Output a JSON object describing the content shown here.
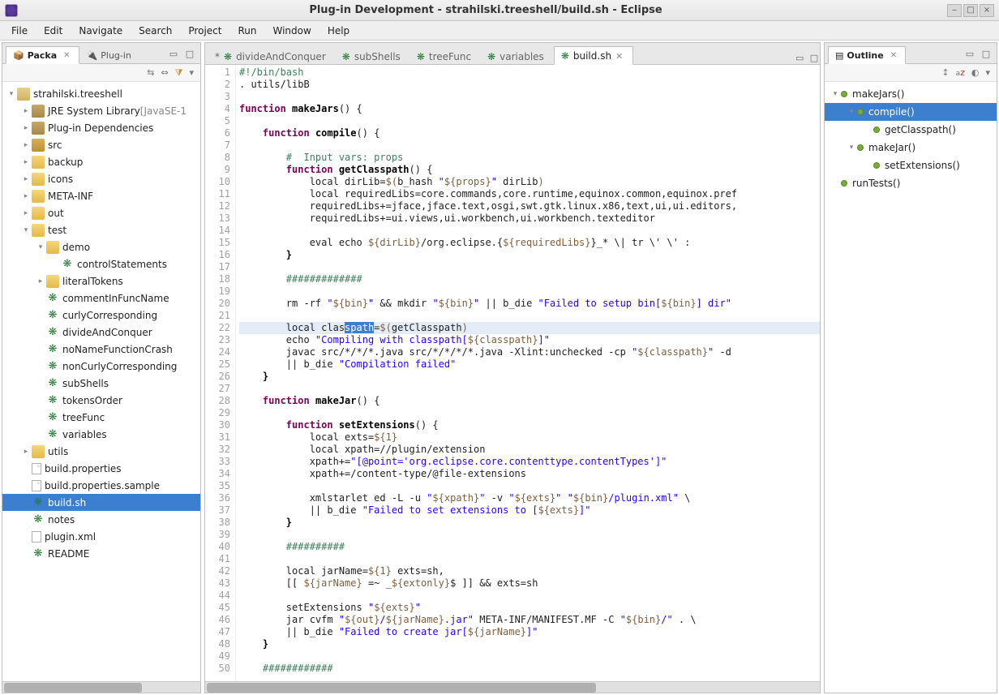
{
  "window": {
    "title": "Plug-in Development - strahilski.treeshell/build.sh - Eclipse"
  },
  "menubar": [
    "File",
    "Edit",
    "Navigate",
    "Search",
    "Project",
    "Run",
    "Window",
    "Help"
  ],
  "left": {
    "tabs": [
      {
        "label": "Packa",
        "active": true,
        "icon": "package-explorer"
      },
      {
        "label": "Plug-in",
        "active": false,
        "icon": "plugin"
      }
    ],
    "project": "strahilski.treeshell",
    "tree": [
      {
        "depth": 1,
        "tw": "+",
        "icon": "lib",
        "label": "JRE System Library",
        "suffix": " [JavaSE-1"
      },
      {
        "depth": 1,
        "tw": "+",
        "icon": "lib",
        "label": "Plug-in Dependencies"
      },
      {
        "depth": 1,
        "tw": "+",
        "icon": "folder-src",
        "label": "src"
      },
      {
        "depth": 1,
        "tw": "+",
        "icon": "folder",
        "label": "backup"
      },
      {
        "depth": 1,
        "tw": "+",
        "icon": "folder",
        "label": "icons"
      },
      {
        "depth": 1,
        "tw": "+",
        "icon": "folder",
        "label": "META-INF"
      },
      {
        "depth": 1,
        "tw": "+",
        "icon": "folder",
        "label": "out"
      },
      {
        "depth": 1,
        "tw": "-",
        "icon": "folder",
        "label": "test"
      },
      {
        "depth": 2,
        "tw": "-",
        "icon": "folder",
        "label": "demo"
      },
      {
        "depth": 3,
        "tw": "",
        "icon": "bug",
        "label": "controlStatements"
      },
      {
        "depth": 2,
        "tw": "+",
        "icon": "folder",
        "label": "literalTokens"
      },
      {
        "depth": 2,
        "tw": "",
        "icon": "bug",
        "label": "commentInFuncName"
      },
      {
        "depth": 2,
        "tw": "",
        "icon": "bug",
        "label": "curlyCorresponding"
      },
      {
        "depth": 2,
        "tw": "",
        "icon": "bug",
        "label": "divideAndConquer"
      },
      {
        "depth": 2,
        "tw": "",
        "icon": "bug",
        "label": "noNameFunctionCrash"
      },
      {
        "depth": 2,
        "tw": "",
        "icon": "bug",
        "label": "nonCurlyCorresponding"
      },
      {
        "depth": 2,
        "tw": "",
        "icon": "bug",
        "label": "subShells"
      },
      {
        "depth": 2,
        "tw": "",
        "icon": "bug",
        "label": "tokensOrder"
      },
      {
        "depth": 2,
        "tw": "",
        "icon": "bug",
        "label": "treeFunc"
      },
      {
        "depth": 2,
        "tw": "",
        "icon": "bug",
        "label": "variables"
      },
      {
        "depth": 1,
        "tw": "+",
        "icon": "folder",
        "label": "utils"
      },
      {
        "depth": 1,
        "tw": "",
        "icon": "file",
        "label": "build.properties"
      },
      {
        "depth": 1,
        "tw": "",
        "icon": "file",
        "label": "build.properties.sample"
      },
      {
        "depth": 1,
        "tw": "",
        "icon": "bug",
        "label": "build.sh",
        "selected": true
      },
      {
        "depth": 1,
        "tw": "",
        "icon": "bug",
        "label": "notes"
      },
      {
        "depth": 1,
        "tw": "",
        "icon": "xml",
        "label": "plugin.xml"
      },
      {
        "depth": 1,
        "tw": "",
        "icon": "bug",
        "label": "README"
      }
    ]
  },
  "editor": {
    "tabs": [
      {
        "label": "divideAndConquer",
        "dirty": true
      },
      {
        "label": "subShells"
      },
      {
        "label": "treeFunc"
      },
      {
        "label": "variables"
      },
      {
        "label": "build.sh",
        "active": true
      }
    ],
    "lines": [
      {
        "n": 1,
        "seg": [
          {
            "t": "#!/bin/bash",
            "c": "cmt"
          }
        ]
      },
      {
        "n": 2,
        "seg": [
          {
            "t": ". utils/libB"
          }
        ]
      },
      {
        "n": 3,
        "seg": []
      },
      {
        "n": 4,
        "seg": [
          {
            "t": "function",
            "c": "kw"
          },
          {
            "t": " "
          },
          {
            "t": "makeJars",
            "c": "fn"
          },
          {
            "t": "() {"
          }
        ]
      },
      {
        "n": 5,
        "seg": []
      },
      {
        "n": 6,
        "seg": [
          {
            "t": "    "
          },
          {
            "t": "function",
            "c": "kw"
          },
          {
            "t": " "
          },
          {
            "t": "compile",
            "c": "fn"
          },
          {
            "t": "() {"
          }
        ]
      },
      {
        "n": 7,
        "seg": []
      },
      {
        "n": 8,
        "seg": [
          {
            "t": "        "
          },
          {
            "t": "#  Input vars: props",
            "c": "cmt"
          }
        ]
      },
      {
        "n": 9,
        "seg": [
          {
            "t": "        "
          },
          {
            "t": "function",
            "c": "kw"
          },
          {
            "t": " "
          },
          {
            "t": "getClasspath",
            "c": "fn"
          },
          {
            "t": "() {"
          }
        ]
      },
      {
        "n": 10,
        "seg": [
          {
            "t": "            local dirLib="
          },
          {
            "t": "$(",
            "c": "var"
          },
          {
            "t": "b_hash "
          },
          {
            "t": "\"",
            "c": "str"
          },
          {
            "t": "${props}",
            "c": "var"
          },
          {
            "t": "\"",
            "c": "str"
          },
          {
            "t": " dirLib"
          },
          {
            "t": ")",
            "c": "var"
          }
        ]
      },
      {
        "n": 11,
        "seg": [
          {
            "t": "            local requiredLibs=core.commands,core.runtime,equinox.common,equinox.pref"
          }
        ]
      },
      {
        "n": 12,
        "seg": [
          {
            "t": "            requiredLibs+=jface,jface.text,osgi,swt.gtk.linux.x86,text,ui,ui.editors,"
          }
        ]
      },
      {
        "n": 13,
        "seg": [
          {
            "t": "            requiredLibs+=ui.views,ui.workbench,ui.workbench.texteditor"
          }
        ]
      },
      {
        "n": 14,
        "seg": []
      },
      {
        "n": 15,
        "seg": [
          {
            "t": "            eval echo "
          },
          {
            "t": "${dirLib}",
            "c": "var"
          },
          {
            "t": "/org.eclipse.{"
          },
          {
            "t": "${requiredLibs}",
            "c": "var"
          },
          {
            "t": "}_* \\| tr \\' \\' :"
          }
        ]
      },
      {
        "n": 16,
        "seg": [
          {
            "t": "        "
          },
          {
            "t": "}",
            "c": "fn"
          }
        ]
      },
      {
        "n": 17,
        "seg": []
      },
      {
        "n": 18,
        "seg": [
          {
            "t": "        "
          },
          {
            "t": "#############",
            "c": "cmt"
          }
        ]
      },
      {
        "n": 19,
        "seg": []
      },
      {
        "n": 20,
        "seg": [
          {
            "t": "        rm -rf "
          },
          {
            "t": "\"",
            "c": "str"
          },
          {
            "t": "${bin}",
            "c": "var"
          },
          {
            "t": "\"",
            "c": "str"
          },
          {
            "t": " && mkdir "
          },
          {
            "t": "\"",
            "c": "str"
          },
          {
            "t": "${bin}",
            "c": "var"
          },
          {
            "t": "\"",
            "c": "str"
          },
          {
            "t": " || b_die "
          },
          {
            "t": "\"Failed to setup bin[",
            "c": "str"
          },
          {
            "t": "${bin}",
            "c": "var"
          },
          {
            "t": "] dir\"",
            "c": "str"
          }
        ]
      },
      {
        "n": 21,
        "seg": []
      },
      {
        "n": 22,
        "hl": true,
        "seg": [
          {
            "t": "        local clas"
          },
          {
            "t": "spath",
            "c": "sel"
          },
          {
            "t": "="
          },
          {
            "t": "$(",
            "c": "var"
          },
          {
            "t": "getClasspath"
          },
          {
            "t": ")",
            "c": "var"
          }
        ]
      },
      {
        "n": 23,
        "seg": [
          {
            "t": "        echo "
          },
          {
            "t": "\"Compiling with classpath[",
            "c": "str"
          },
          {
            "t": "${classpath}",
            "c": "var"
          },
          {
            "t": "]\"",
            "c": "str"
          }
        ]
      },
      {
        "n": 24,
        "seg": [
          {
            "t": "        javac src/*/*/*.java src/*/*/*/*.java -Xlint:unchecked -cp "
          },
          {
            "t": "\"",
            "c": "str"
          },
          {
            "t": "${classpath}",
            "c": "var"
          },
          {
            "t": "\"",
            "c": "str"
          },
          {
            "t": " -d"
          }
        ]
      },
      {
        "n": 25,
        "seg": [
          {
            "t": "        || b_die "
          },
          {
            "t": "\"Compilation failed\"",
            "c": "str"
          }
        ]
      },
      {
        "n": 26,
        "seg": [
          {
            "t": "    "
          },
          {
            "t": "}",
            "c": "fn"
          }
        ]
      },
      {
        "n": 27,
        "seg": []
      },
      {
        "n": 28,
        "seg": [
          {
            "t": "    "
          },
          {
            "t": "function",
            "c": "kw"
          },
          {
            "t": " "
          },
          {
            "t": "makeJar",
            "c": "fn"
          },
          {
            "t": "() {"
          }
        ]
      },
      {
        "n": 29,
        "seg": []
      },
      {
        "n": 30,
        "seg": [
          {
            "t": "        "
          },
          {
            "t": "function",
            "c": "kw"
          },
          {
            "t": " "
          },
          {
            "t": "setExtensions",
            "c": "fn"
          },
          {
            "t": "() {"
          }
        ]
      },
      {
        "n": 31,
        "seg": [
          {
            "t": "            local exts="
          },
          {
            "t": "${1}",
            "c": "var"
          }
        ]
      },
      {
        "n": 32,
        "seg": [
          {
            "t": "            local xpath=//plugin/extension"
          }
        ]
      },
      {
        "n": 33,
        "seg": [
          {
            "t": "            xpath+="
          },
          {
            "t": "\"[@point='org.eclipse.core.contenttype.contentTypes']\"",
            "c": "str"
          }
        ]
      },
      {
        "n": 34,
        "seg": [
          {
            "t": "            xpath+=/content-type/@file-extensions"
          }
        ]
      },
      {
        "n": 35,
        "seg": []
      },
      {
        "n": 36,
        "seg": [
          {
            "t": "            xmlstarlet ed -L -u "
          },
          {
            "t": "\"",
            "c": "str"
          },
          {
            "t": "${xpath}",
            "c": "var"
          },
          {
            "t": "\"",
            "c": "str"
          },
          {
            "t": " -v "
          },
          {
            "t": "\"",
            "c": "str"
          },
          {
            "t": "${exts}",
            "c": "var"
          },
          {
            "t": "\"",
            "c": "str"
          },
          {
            "t": " "
          },
          {
            "t": "\"",
            "c": "str"
          },
          {
            "t": "${bin}",
            "c": "var"
          },
          {
            "t": "/plugin.xml\"",
            "c": "str"
          },
          {
            "t": " \\"
          }
        ]
      },
      {
        "n": 37,
        "seg": [
          {
            "t": "            || b_die "
          },
          {
            "t": "\"Failed to set extensions to [",
            "c": "str"
          },
          {
            "t": "${exts}",
            "c": "var"
          },
          {
            "t": "]\"",
            "c": "str"
          }
        ]
      },
      {
        "n": 38,
        "seg": [
          {
            "t": "        "
          },
          {
            "t": "}",
            "c": "fn"
          }
        ]
      },
      {
        "n": 39,
        "seg": []
      },
      {
        "n": 40,
        "seg": [
          {
            "t": "        "
          },
          {
            "t": "##########",
            "c": "cmt"
          }
        ]
      },
      {
        "n": 41,
        "seg": []
      },
      {
        "n": 42,
        "seg": [
          {
            "t": "        local jarName="
          },
          {
            "t": "${1}",
            "c": "var"
          },
          {
            "t": " exts=sh,"
          }
        ]
      },
      {
        "n": 43,
        "seg": [
          {
            "t": "        [[ "
          },
          {
            "t": "${jarName}",
            "c": "var"
          },
          {
            "t": " =~ _"
          },
          {
            "t": "${extonly}",
            "c": "var"
          },
          {
            "t": "$ ]] && exts=sh"
          }
        ]
      },
      {
        "n": 44,
        "seg": []
      },
      {
        "n": 45,
        "seg": [
          {
            "t": "        setExtensions "
          },
          {
            "t": "\"",
            "c": "str"
          },
          {
            "t": "${exts}",
            "c": "var"
          },
          {
            "t": "\"",
            "c": "str"
          }
        ]
      },
      {
        "n": 46,
        "seg": [
          {
            "t": "        jar cvfm "
          },
          {
            "t": "\"",
            "c": "str"
          },
          {
            "t": "${out}",
            "c": "var"
          },
          {
            "t": "/",
            "c": "str"
          },
          {
            "t": "${jarName}",
            "c": "var"
          },
          {
            "t": ".jar\"",
            "c": "str"
          },
          {
            "t": " META-INF/MANIFEST.MF -C "
          },
          {
            "t": "\"",
            "c": "str"
          },
          {
            "t": "${bin}",
            "c": "var"
          },
          {
            "t": "/\"",
            "c": "str"
          },
          {
            "t": " . \\"
          }
        ]
      },
      {
        "n": 47,
        "seg": [
          {
            "t": "        || b_die "
          },
          {
            "t": "\"Failed to create jar[",
            "c": "str"
          },
          {
            "t": "${jarName}",
            "c": "var"
          },
          {
            "t": "]\"",
            "c": "str"
          }
        ]
      },
      {
        "n": 48,
        "seg": [
          {
            "t": "    "
          },
          {
            "t": "}",
            "c": "fn"
          }
        ]
      },
      {
        "n": 49,
        "seg": []
      },
      {
        "n": 50,
        "seg": [
          {
            "t": "    "
          },
          {
            "t": "############",
            "c": "cmt"
          }
        ]
      }
    ]
  },
  "outline": {
    "tab": "Outline",
    "items": [
      {
        "depth": 0,
        "tw": "-",
        "label": "makeJars()"
      },
      {
        "depth": 1,
        "tw": "-",
        "label": "compile()",
        "selected": true
      },
      {
        "depth": 2,
        "tw": "",
        "label": "getClasspath()"
      },
      {
        "depth": 1,
        "tw": "-",
        "label": "makeJar()"
      },
      {
        "depth": 2,
        "tw": "",
        "label": "setExtensions()"
      },
      {
        "depth": 0,
        "tw": "",
        "label": "runTests()"
      }
    ]
  }
}
